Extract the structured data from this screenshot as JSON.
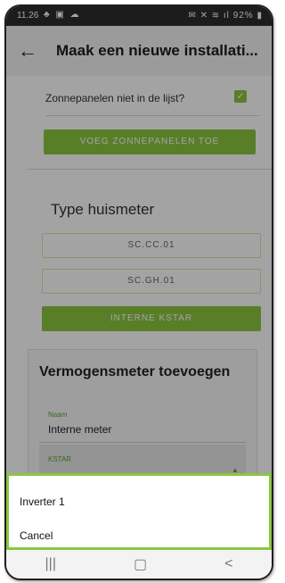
{
  "status_bar": {
    "time": "11.26",
    "battery": "92%"
  },
  "appbar": {
    "title": "Maak een nieuwe installati..."
  },
  "solar": {
    "not_listed_label": "Zonnepanelen niet in de lijst?",
    "checked": true,
    "add_button": "VOEG ZONNEPANELEN TOE"
  },
  "meter_type": {
    "title": "Type huismeter",
    "options": [
      "SC.CC.01",
      "SC.GH.01",
      "INTERNE KSTAR"
    ]
  },
  "power_meter": {
    "title": "Vermogensmeter toevoegen",
    "name_label": "Naam",
    "name_value": "Interne meter",
    "kstar_label": "KSTAR"
  },
  "popup_menu": {
    "items": [
      "Inverter 1",
      "Cancel"
    ]
  },
  "colors": {
    "accent": "#8cc63f",
    "popup_border": "#8cc63f",
    "statusbar": "#2d2d2d"
  },
  "icons": [
    "back-arrow-icon",
    "recent-apps-icon",
    "home-icon",
    "back-nav-icon",
    "dropdown-caret-icon"
  ]
}
